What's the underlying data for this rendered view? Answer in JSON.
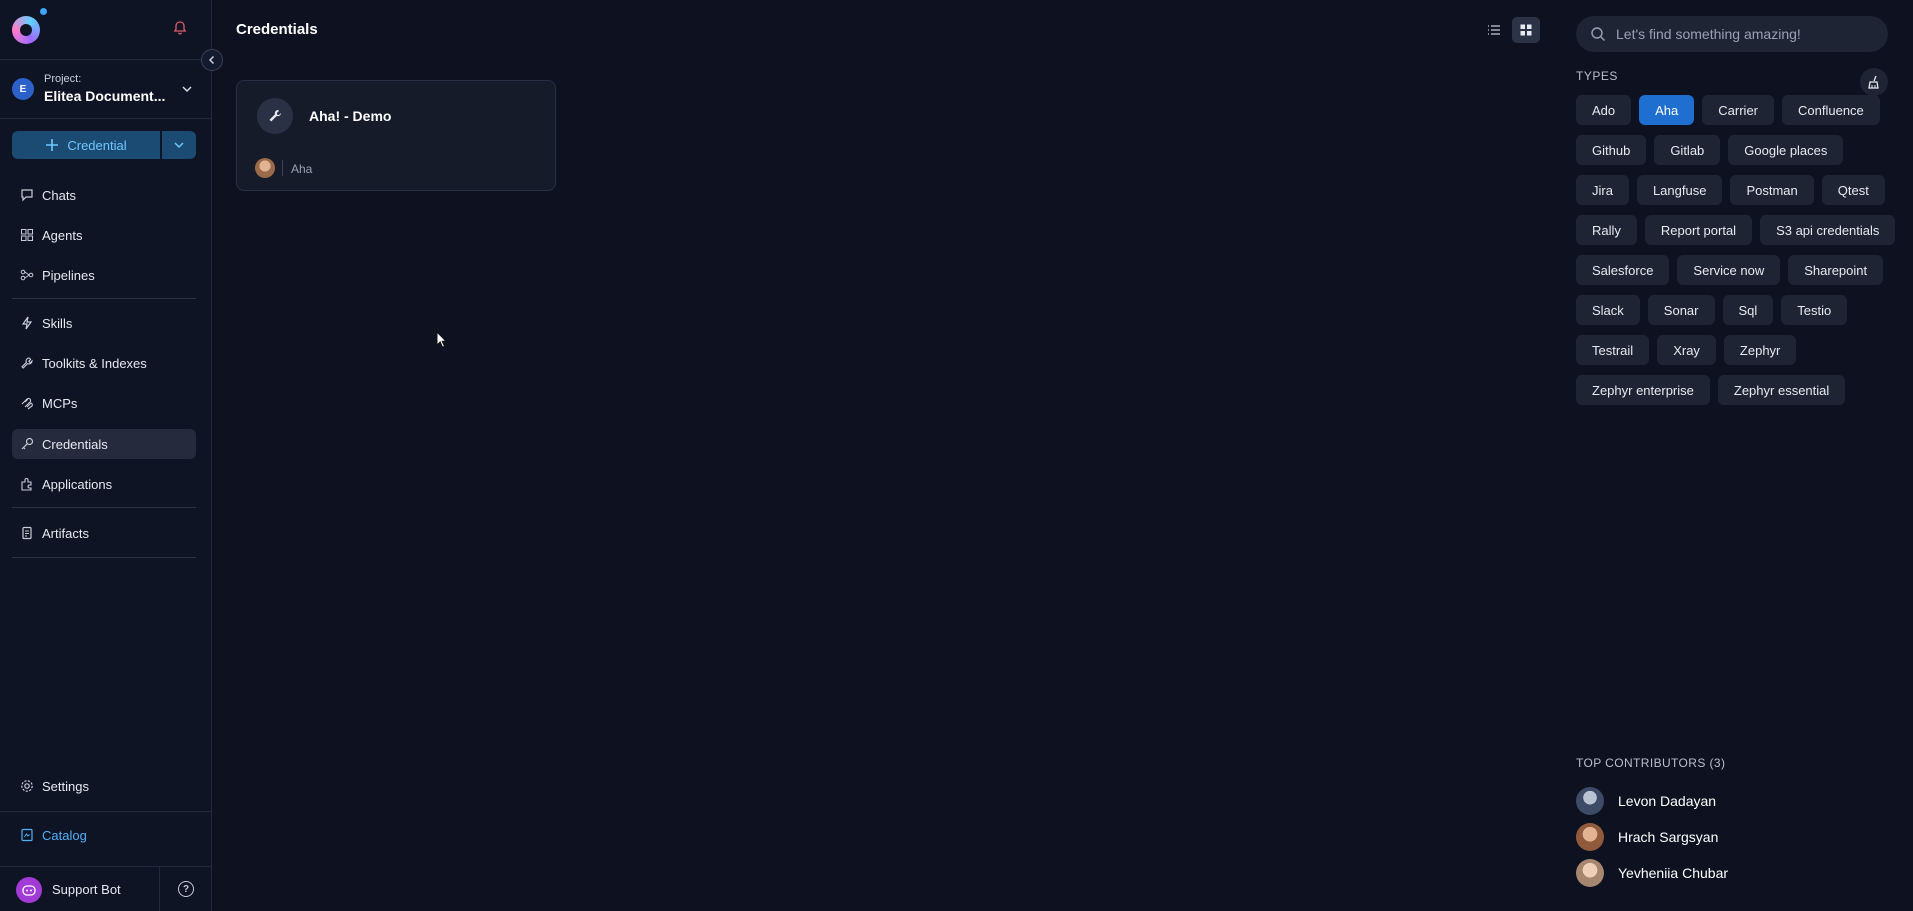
{
  "sidebar": {
    "project_label": "Project:",
    "project_name": "Elitea Document...",
    "project_initial": "E",
    "new_button_label": "Credential",
    "nav_group1": [
      {
        "label": "Chats",
        "icon": "chat-icon"
      },
      {
        "label": "Agents",
        "icon": "agents-icon"
      },
      {
        "label": "Pipelines",
        "icon": "pipelines-icon"
      }
    ],
    "nav_group2": [
      {
        "label": "Skills",
        "icon": "skills-icon"
      },
      {
        "label": "Toolkits & Indexes",
        "icon": "toolkits-icon"
      },
      {
        "label": "MCPs",
        "icon": "mcp-icon"
      },
      {
        "label": "Credentials",
        "icon": "key-icon",
        "active": true
      },
      {
        "label": "Applications",
        "icon": "applications-icon"
      }
    ],
    "nav_group3": [
      {
        "label": "Artifacts",
        "icon": "artifacts-icon"
      }
    ],
    "settings_label": "Settings",
    "catalog_label": "Catalog",
    "support_bot_label": "Support Bot"
  },
  "main": {
    "title": "Credentials",
    "cards": [
      {
        "title": "Aha! - Demo",
        "type": "Aha"
      }
    ]
  },
  "right_panel": {
    "search_placeholder": "Let's find something amazing!",
    "types_label": "TYPES",
    "types": [
      {
        "label": "Ado"
      },
      {
        "label": "Aha",
        "selected": true
      },
      {
        "label": "Carrier"
      },
      {
        "label": "Confluence"
      },
      {
        "label": "Github"
      },
      {
        "label": "Gitlab"
      },
      {
        "label": "Google places"
      },
      {
        "label": "Jira"
      },
      {
        "label": "Langfuse"
      },
      {
        "label": "Postman"
      },
      {
        "label": "Qtest"
      },
      {
        "label": "Rally"
      },
      {
        "label": "Report portal"
      },
      {
        "label": "S3 api credentials"
      },
      {
        "label": "Salesforce"
      },
      {
        "label": "Service now"
      },
      {
        "label": "Sharepoint"
      },
      {
        "label": "Slack"
      },
      {
        "label": "Sonar"
      },
      {
        "label": "Sql"
      },
      {
        "label": "Testio"
      },
      {
        "label": "Testrail"
      },
      {
        "label": "Xray"
      },
      {
        "label": "Zephyr"
      },
      {
        "label": "Zephyr enterprise"
      },
      {
        "label": "Zephyr essential"
      }
    ],
    "contributors_label": "TOP CONTRIBUTORS (3)",
    "contributors": [
      {
        "name": "Levon Dadayan"
      },
      {
        "name": "Hrach Sargsyan"
      },
      {
        "name": "Yevheniia Chubar"
      }
    ]
  },
  "colors": {
    "background": "#0e1220",
    "accent": "#1f6fd1",
    "link": "#4fb0f5"
  }
}
